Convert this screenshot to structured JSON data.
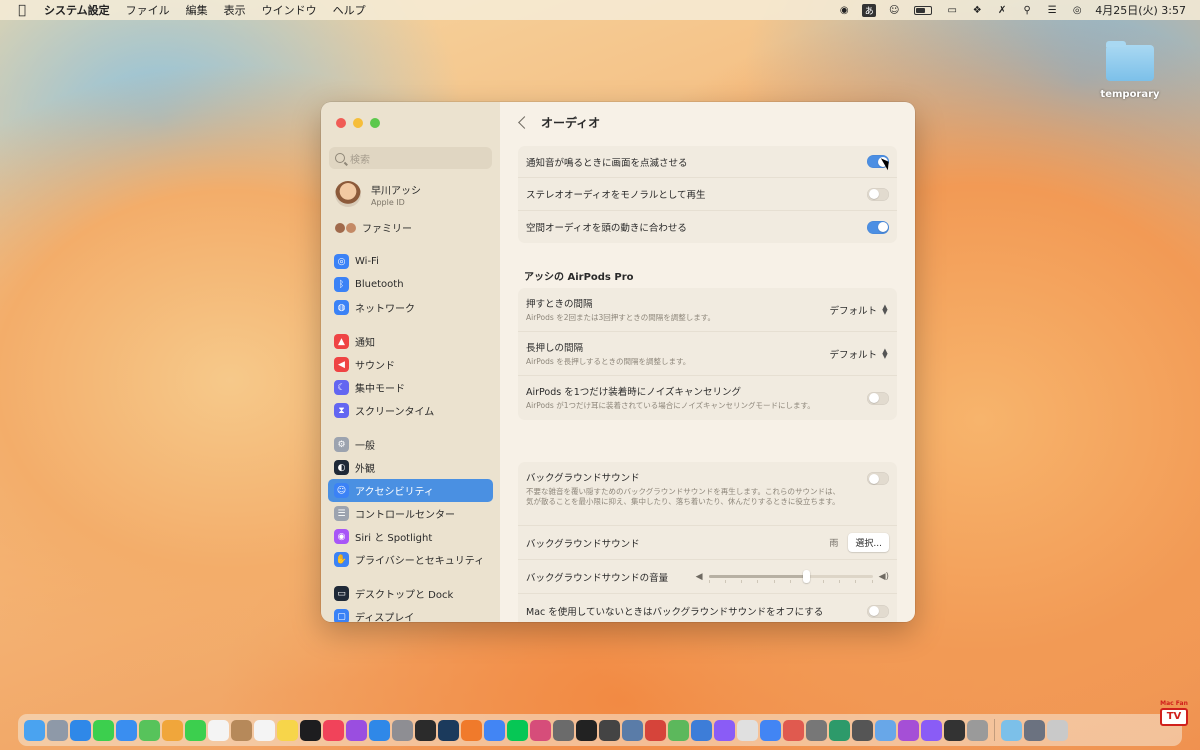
{
  "menubar": {
    "app_name": "システム設定",
    "menus": [
      "ファイル",
      "編集",
      "表示",
      "ウインドウ",
      "ヘルプ"
    ],
    "ime_label": "あ",
    "clock": "4月25日(火)  3:57"
  },
  "desktop": {
    "folder_label": "temporary"
  },
  "sidebar": {
    "search_placeholder": "検索",
    "account": {
      "name": "早川アッシ",
      "sub": "Apple ID"
    },
    "family": "ファミリー",
    "items": [
      {
        "label": "Wi-Fi",
        "icon": "wifi-icon",
        "color": "#3b82f6"
      },
      {
        "label": "Bluetooth",
        "icon": "bluetooth-icon",
        "color": "#3b82f6"
      },
      {
        "label": "ネットワーク",
        "icon": "globe-icon",
        "color": "#3b82f6"
      },
      {
        "label": "通知",
        "icon": "bell-icon",
        "color": "#ef4444"
      },
      {
        "label": "サウンド",
        "icon": "speaker-icon",
        "color": "#ef4444"
      },
      {
        "label": "集中モード",
        "icon": "moon-icon",
        "color": "#6366f1"
      },
      {
        "label": "スクリーンタイム",
        "icon": "hourglass-icon",
        "color": "#6366f1"
      },
      {
        "label": "一般",
        "icon": "gear-icon",
        "color": "#9ca3af"
      },
      {
        "label": "外観",
        "icon": "appearance-icon",
        "color": "#1f2937"
      },
      {
        "label": "アクセシビリティ",
        "icon": "accessibility-icon",
        "color": "#3b82f6"
      },
      {
        "label": "コントロールセンター",
        "icon": "control-center-icon",
        "color": "#9ca3af"
      },
      {
        "label": "Siri と Spotlight",
        "icon": "siri-icon",
        "color": "#a855f7"
      },
      {
        "label": "プライバシーとセキュリティ",
        "icon": "hand-icon",
        "color": "#3b82f6"
      },
      {
        "label": "デスクトップと Dock",
        "icon": "dock-icon",
        "color": "#1f2937"
      },
      {
        "label": "ディスプレイ",
        "icon": "display-icon",
        "color": "#3b82f6"
      }
    ],
    "active_index": 9
  },
  "main": {
    "title": "オーディオ",
    "group1": [
      {
        "label": "通知音が鳴るときに画面を点滅させる",
        "on": true
      },
      {
        "label": "ステレオオーディオをモノラルとして再生",
        "on": false
      },
      {
        "label": "空間オーディオを頭の動きに合わせる",
        "on": true
      }
    ],
    "airpods_title": "アッシの AirPods Pro",
    "airpods": {
      "press_label": "押すときの間隔",
      "press_sub": "AirPods を2回または3回押すときの間隔を調整します。",
      "press_value": "デフォルト",
      "hold_label": "長押しの間隔",
      "hold_sub": "AirPods を長押しするときの間隔を調整します。",
      "hold_value": "デフォルト",
      "nc_label": "AirPods を1つだけ装着時にノイズキャンセリング",
      "nc_sub": "AirPods が1つだけ耳に装着されている場合にノイズキャンセリングモードにします。",
      "nc_on": false
    },
    "background": {
      "toggle_label": "バックグラウンドサウンド",
      "toggle_sub": "不要な雑音を覆い隠すためのバックグラウンドサウンドを再生します。これらのサウンドは、気が散ることを最小限に抑え、集中したり、落ち着いたり、休んだりするときに役立ちます。",
      "toggle_on": false,
      "sound_label": "バックグラウンドサウンド",
      "sound_value": "雨",
      "select_button": "選択...",
      "volume_label": "バックグラウンドサウンドの音量",
      "volume_fraction": 0.6,
      "off_label": "Mac を使用していないときはバックグラウンドサウンドをオフにする",
      "off_on": false
    }
  },
  "dock": {
    "apps": [
      {
        "icon": "finder-icon",
        "color": "#4aa3f0"
      },
      {
        "icon": "launchpad-icon",
        "color": "#8e99a8"
      },
      {
        "icon": "safari-icon",
        "color": "#2f88e8"
      },
      {
        "icon": "messages-icon",
        "color": "#3ccf4e"
      },
      {
        "icon": "mail-icon",
        "color": "#3a8ef0"
      },
      {
        "icon": "maps-icon",
        "color": "#57c35b"
      },
      {
        "icon": "photos-icon",
        "color": "#f0a63b"
      },
      {
        "icon": "facetime-icon",
        "color": "#3ccf4e"
      },
      {
        "icon": "calendar-icon",
        "color": "#f4f4f4"
      },
      {
        "icon": "contacts-icon",
        "color": "#b6895a"
      },
      {
        "icon": "reminders-icon",
        "color": "#f4f4f4"
      },
      {
        "icon": "notes-icon",
        "color": "#f7d54a"
      },
      {
        "icon": "tv-icon",
        "color": "#1d1d1f"
      },
      {
        "icon": "music-icon",
        "color": "#f1435a"
      },
      {
        "icon": "podcasts-icon",
        "color": "#9a4ee0"
      },
      {
        "icon": "appstore-icon",
        "color": "#2f88e8"
      },
      {
        "icon": "settings-icon",
        "color": "#8e8e93"
      },
      {
        "icon": "finalcut-icon",
        "color": "#2b2b2b"
      },
      {
        "icon": "photoshop-icon",
        "color": "#1b3a5c"
      },
      {
        "icon": "firefox-icon",
        "color": "#f07a2b"
      },
      {
        "icon": "chrome-icon",
        "color": "#4285f4"
      },
      {
        "icon": "line-icon",
        "color": "#06c755"
      },
      {
        "icon": "app-icon",
        "color": "#d64d7a"
      },
      {
        "icon": "app-icon",
        "color": "#6b6b6b"
      },
      {
        "icon": "app-icon",
        "color": "#222222"
      },
      {
        "icon": "app-icon",
        "color": "#444444"
      },
      {
        "icon": "app-icon",
        "color": "#5a7ca8"
      },
      {
        "icon": "app-icon",
        "color": "#d6443a"
      },
      {
        "icon": "app-icon",
        "color": "#5cb85c"
      },
      {
        "icon": "app-icon",
        "color": "#3d7dd8"
      },
      {
        "icon": "messenger-icon",
        "color": "#8a5cf6"
      },
      {
        "icon": "app-icon",
        "color": "#e0e0e0"
      },
      {
        "icon": "app-icon",
        "color": "#4285f4"
      },
      {
        "icon": "app-icon",
        "color": "#e05a4f"
      },
      {
        "icon": "app-icon",
        "color": "#777777"
      },
      {
        "icon": "app-icon",
        "color": "#2d9a6a"
      },
      {
        "icon": "app-icon",
        "color": "#555555"
      },
      {
        "icon": "app-icon",
        "color": "#68a7e8"
      },
      {
        "icon": "app-icon",
        "color": "#a54fd6"
      },
      {
        "icon": "app-icon",
        "color": "#8a5cf6"
      },
      {
        "icon": "app-icon",
        "color": "#333333"
      },
      {
        "icon": "app-icon",
        "color": "#9a9a9a"
      }
    ],
    "right": [
      {
        "icon": "folder-icon",
        "color": "#7cc0e9"
      },
      {
        "icon": "app-icon",
        "color": "#6b7280"
      },
      {
        "icon": "trash-icon",
        "color": "#c9c9c9"
      }
    ]
  },
  "watermark": {
    "top": "Mac Fan",
    "tv": "TV"
  }
}
